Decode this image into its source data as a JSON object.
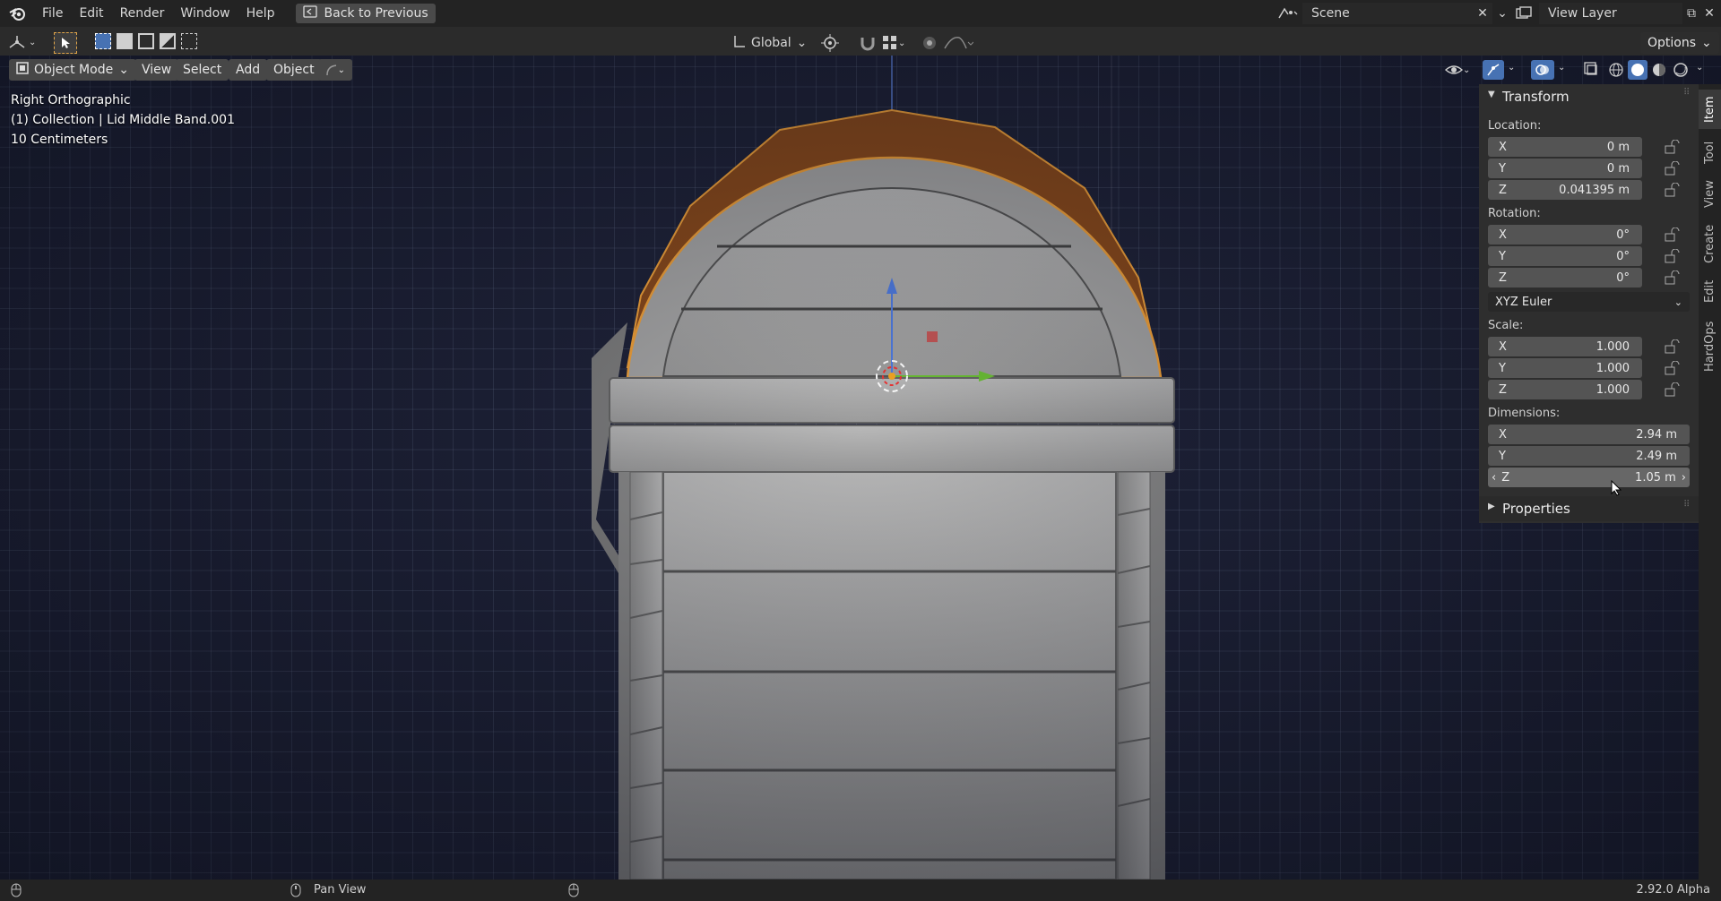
{
  "topbar": {
    "menus": [
      "File",
      "Edit",
      "Render",
      "Window",
      "Help"
    ],
    "back_label": "Back to Previous",
    "scene_label": "Scene",
    "view_layer_label": "View Layer"
  },
  "tool_header": {
    "orientation": "Global",
    "options": "Options"
  },
  "viewport_header": {
    "mode": "Object Mode",
    "menus": [
      "View",
      "Select",
      "Add",
      "Object"
    ]
  },
  "overlay": {
    "view_name": "Right Orthographic",
    "object_info": "(1) Collection | Lid  Middle Band.001",
    "scale": "10 Centimeters"
  },
  "npanel": {
    "transform_title": "Transform",
    "location_label": "Location:",
    "location": [
      {
        "axis": "X",
        "value": "0 m"
      },
      {
        "axis": "Y",
        "value": "0 m"
      },
      {
        "axis": "Z",
        "value": "0.041395 m"
      }
    ],
    "rotation_label": "Rotation:",
    "rotation": [
      {
        "axis": "X",
        "value": "0°"
      },
      {
        "axis": "Y",
        "value": "0°"
      },
      {
        "axis": "Z",
        "value": "0°"
      }
    ],
    "rotation_mode": "XYZ Euler",
    "scale_label": "Scale:",
    "scale": [
      {
        "axis": "X",
        "value": "1.000"
      },
      {
        "axis": "Y",
        "value": "1.000"
      },
      {
        "axis": "Z",
        "value": "1.000"
      }
    ],
    "dimensions_label": "Dimensions:",
    "dimensions": [
      {
        "axis": "X",
        "value": "2.94 m"
      },
      {
        "axis": "Y",
        "value": "2.49 m"
      },
      {
        "axis": "Z",
        "value": "1.05 m"
      }
    ],
    "properties_title": "Properties",
    "tabs": [
      "Item",
      "Tool",
      "View",
      "Create",
      "Edit",
      "HardOps"
    ]
  },
  "statusbar": {
    "middle_action": "Pan View",
    "version": "2.92.0 Alpha"
  },
  "colors": {
    "accent_blue": "#4772b3",
    "selection_orange": "#f5a623",
    "lid_brown": "#8a4a1c",
    "viewport_bg": "#1e2238"
  }
}
